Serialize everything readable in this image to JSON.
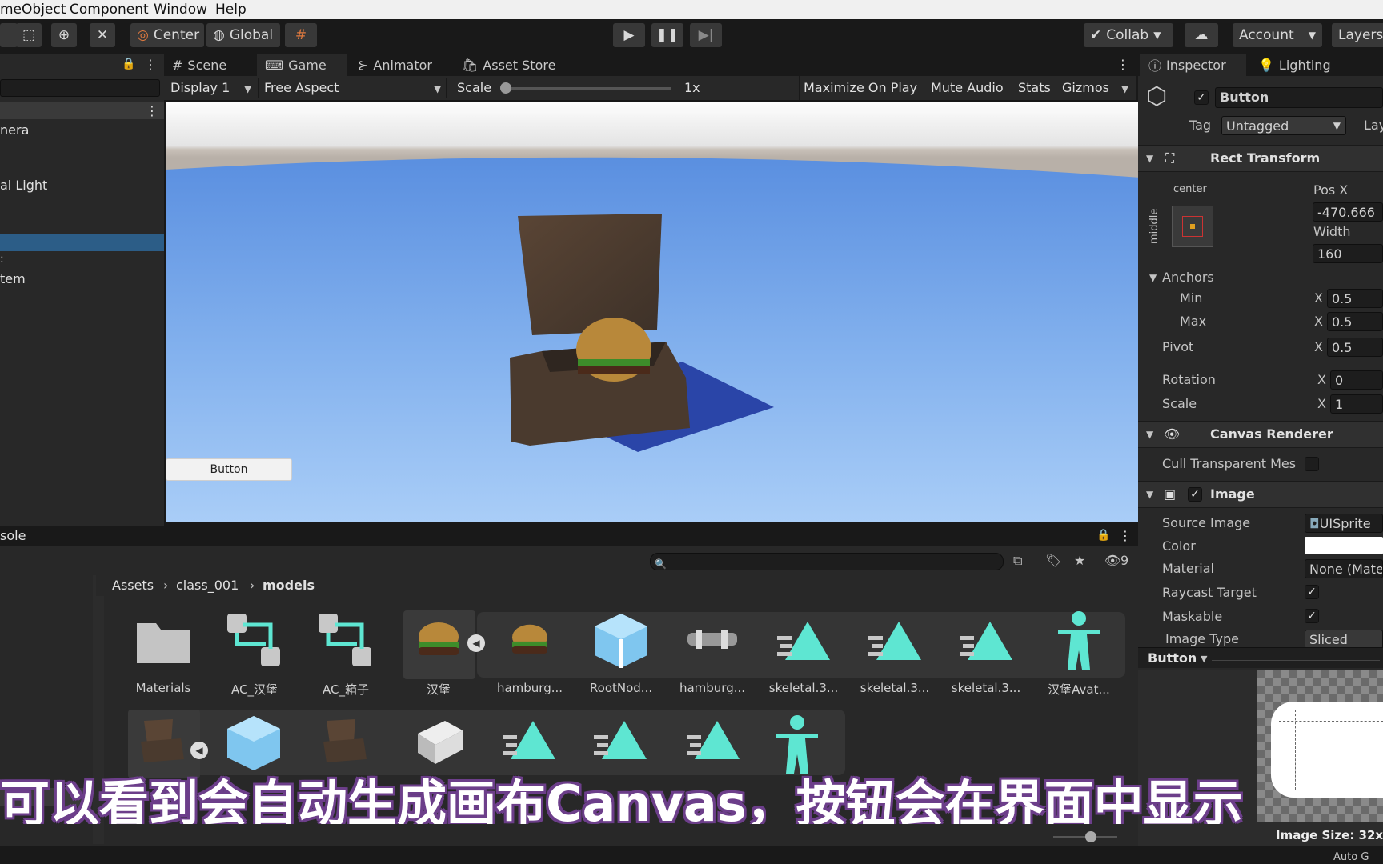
{
  "menubar": {
    "items": [
      "meObject",
      "Component",
      "Window",
      "Help"
    ]
  },
  "toolbar": {
    "center": "Center",
    "global": "Global",
    "collab": "Collab",
    "account": "Account",
    "layers": "Layers"
  },
  "hierarchy": {
    "items": [
      "nera",
      "al Light",
      "",
      "",
      "tem"
    ]
  },
  "game": {
    "tabs": [
      "Scene",
      "Game",
      "Animator",
      "Asset Store"
    ],
    "display": "Display 1",
    "aspect": "Free Aspect",
    "scale_label": "Scale",
    "scale_value": "1x",
    "maximize": "Maximize On Play",
    "mute": "Mute Audio",
    "stats": "Stats",
    "gizmos": "Gizmos",
    "ui_button": "Button"
  },
  "project": {
    "console_tab": "sole",
    "breadcrumb": [
      "Assets",
      "class_001",
      "models"
    ],
    "hidden_count": "9",
    "row1": [
      "Materials",
      "AC_汉堡",
      "AC_箱子",
      "汉堡",
      "hamburg...",
      "RootNod...",
      "hamburg...",
      "skeletal.3...",
      "skeletal.3...",
      "skeletal.3...",
      "汉堡Avat..."
    ]
  },
  "inspector": {
    "tabs": [
      "Inspector",
      "Lighting"
    ],
    "object_name": "Button",
    "tag_label": "Tag",
    "tag_value": "Untagged",
    "layer_label": "Lay",
    "rect_transform": {
      "title": "Rect Transform",
      "anchor_h": "center",
      "anchor_v": "middle",
      "posx_label": "Pos X",
      "posx": "-470.666",
      "width_label": "Width",
      "width": "160",
      "anchors": "Anchors",
      "min": "Min",
      "max": "Max",
      "pivot": "Pivot",
      "rotation": "Rotation",
      "scale": "Scale",
      "x": "X",
      "min_x": "0.5",
      "max_x": "0.5",
      "pivot_x": "0.5",
      "rot_x": "0",
      "scale_x": "1"
    },
    "canvas_renderer": {
      "title": "Canvas Renderer",
      "cull": "Cull Transparent Mes"
    },
    "image": {
      "title": "Image",
      "source_label": "Source Image",
      "source": "UISprite",
      "color_label": "Color",
      "material_label": "Material",
      "material": "None (Mate",
      "raycast": "Raycast Target",
      "maskable": "Maskable",
      "type_label": "Image Type",
      "type": "Sliced"
    },
    "preview": {
      "title": "Button",
      "size": "Image Size: 32x"
    }
  },
  "subtitle": "可以看到会自动生成画布Canvas，按钮会在界面中显示",
  "statusbar": {
    "text": "Auto G"
  },
  "colors": {
    "accent": "#2c5d87",
    "sky_top": "#5a8fe0",
    "asset_teal": "#5ee6d2"
  }
}
